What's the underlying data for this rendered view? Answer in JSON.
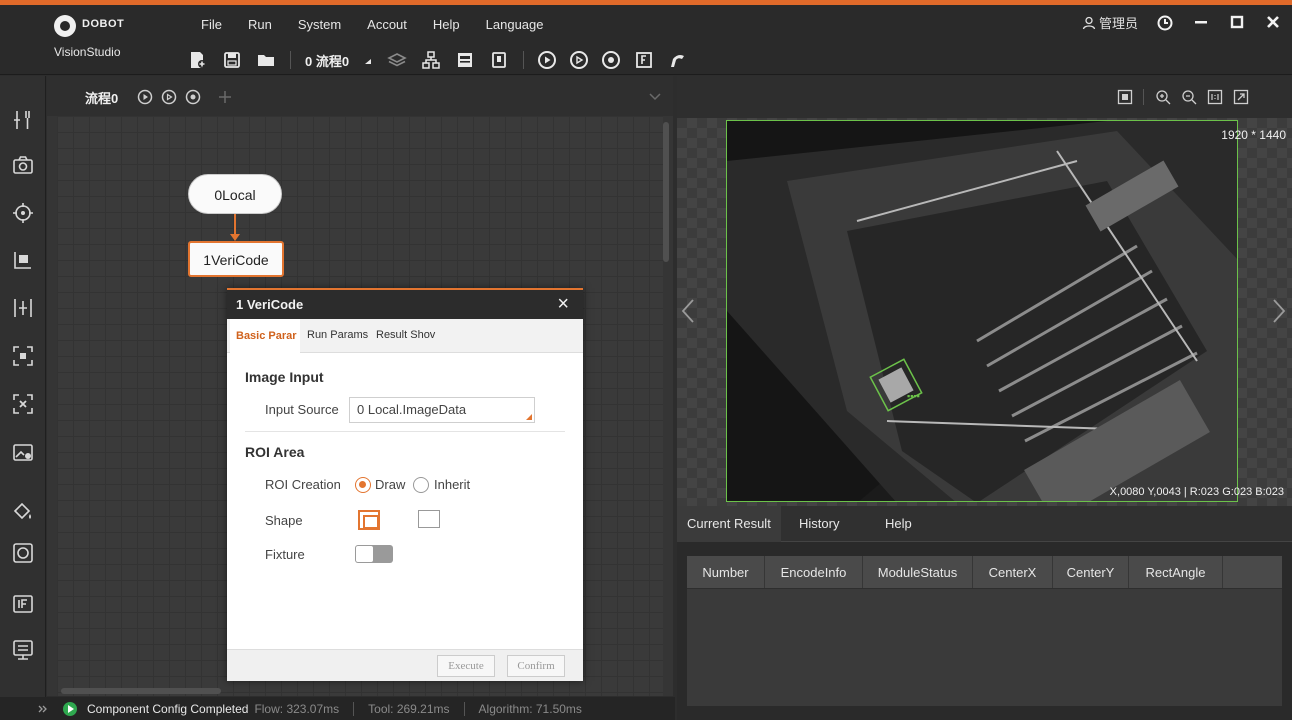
{
  "window": {
    "brand": "DOBOT",
    "product": "VisionStudio",
    "user": "管理员",
    "menu": [
      "File",
      "Run",
      "System",
      "Accout",
      "Help",
      "Language"
    ]
  },
  "toolbar": {
    "flow_selector": "0 流程0"
  },
  "flow": {
    "tab_label": "流程0",
    "nodes": [
      {
        "label": "0Local"
      },
      {
        "label": "1VeriCode"
      }
    ]
  },
  "dialog": {
    "title": "1 VeriCode",
    "close": "×",
    "tabs": [
      "Basic Parar",
      "Run Params",
      "Result Shov"
    ],
    "image_input_section": "Image Input",
    "input_source_label": "Input Source",
    "input_source_value": "0 Local.ImageData",
    "roi_section": "ROI Area",
    "roi_creation_label": "ROI Creation",
    "roi_option_draw": "Draw",
    "roi_option_inherit": "Inherit",
    "shape_label": "Shape",
    "fixture_label": "Fixture",
    "execute_label": "Execute",
    "confirm_label": "Confirm"
  },
  "status": {
    "message": "Component Config Completed",
    "flow": "Flow: 323.07ms",
    "tool": "Tool: 269.21ms",
    "algorithm": "Algorithm: 71.50ms"
  },
  "viewer": {
    "resolution": "1920 * 1440",
    "pixel_info": "X,0080 Y,0043 | R:023 G:023 B:023"
  },
  "results": {
    "tabs": [
      "Current Result",
      "History",
      "Help"
    ],
    "columns": [
      "Number",
      "EncodeInfo",
      "ModuleStatus",
      "CenterX",
      "CenterY",
      "RectAngle"
    ]
  },
  "colors": {
    "accent": "#e37530",
    "roi_green": "#6cc24a",
    "status_ok": "#2fa84f"
  }
}
